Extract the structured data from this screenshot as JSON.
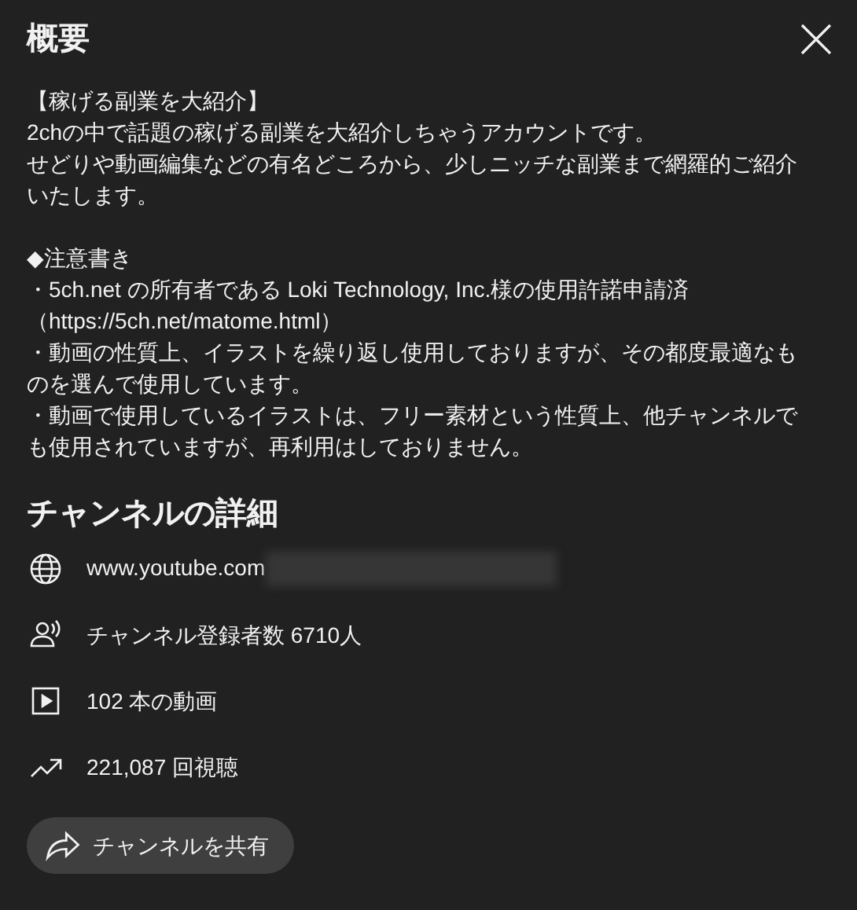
{
  "title": "概要",
  "description": [
    {
      "lines": [
        "【稼げる副業を大紹介】",
        "2chの中で話題の稼げる副業を大紹介しちゃうアカウントです。",
        "せどりや動画編集などの有名どころから、少しニッチな副業まで網羅的ご紹介いたします。"
      ]
    },
    {
      "lines": [
        "◆注意書き",
        "・5ch.net の所有者である Loki Technology, Inc.様の使用許諾申請済（https://5ch.net/matome.html）",
        "・動画の性質上、イラストを繰り返し使用しておりますが、その都度最適なものを選んで使用しています。",
        "・動画で使用しているイラストは、フリー素材という性質上、他チャンネルでも使用されていますが、再利用はしておりません。"
      ]
    }
  ],
  "details_heading": "チャンネルの詳細",
  "details": [
    {
      "kind": "link",
      "text": "www.youtube.com",
      "redacted": true
    },
    {
      "kind": "subscribers",
      "text": "チャンネル登録者数 6710人"
    },
    {
      "kind": "videos",
      "text": "102 本の動画"
    },
    {
      "kind": "views",
      "text": "221,087 回視聴"
    }
  ],
  "share_button": "チャンネルを共有"
}
